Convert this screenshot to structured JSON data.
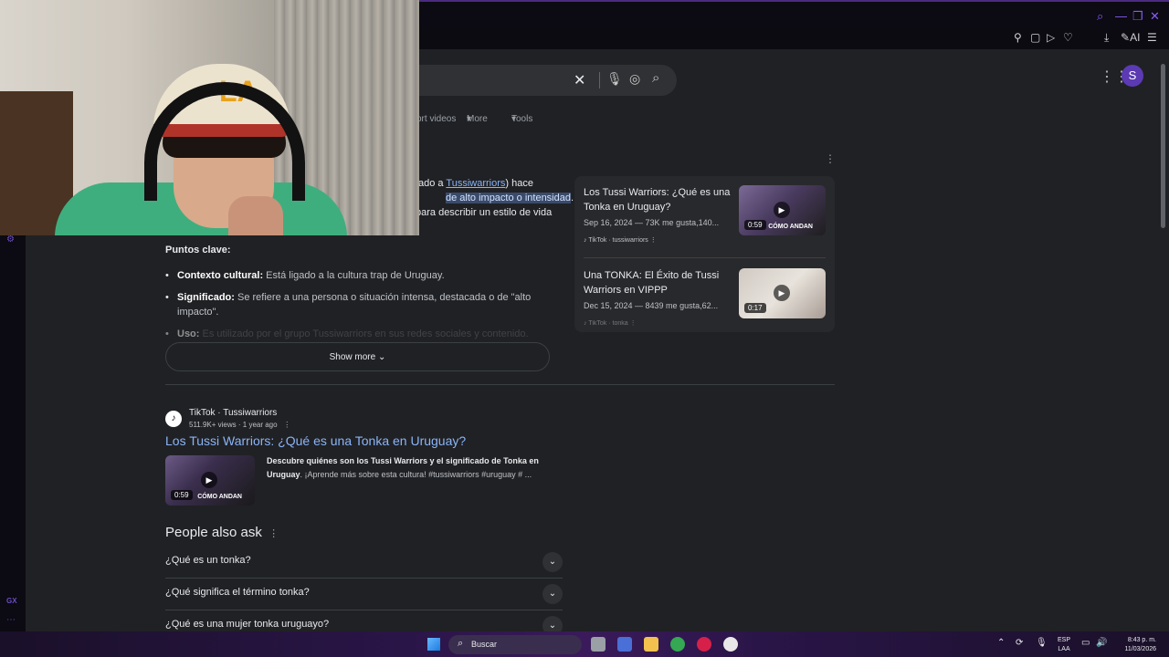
{
  "browser": {
    "toolbar_ai_label": "AI",
    "profile_letter": "S"
  },
  "search": {
    "filters": {
      "short_videos": "ort videos",
      "more": "More",
      "tools": "Tools"
    },
    "avatar_letter": "S"
  },
  "overview": {
    "line1_pre": "ado a ",
    "line1_link": "Tussiwarriors",
    "line1_post": ") hace",
    "line2_hl": "de alto impacto o intensidad",
    "line2_post": ".",
    "line3": "para describir un estilo de vida",
    "keypoints_heading": "Puntos clave:",
    "points": [
      {
        "label": "Contexto cultural:",
        "text": " Está ligado a la cultura trap de Uruguay."
      },
      {
        "label": "Significado:",
        "text": " Se refiere a una persona o situación intensa, destacada o de \"alto impacto\"."
      },
      {
        "label": "Uso:",
        "text": " Es utilizado por el grupo Tussiwarriors en sus redes sociales y contenido."
      }
    ],
    "show_more": "Show more"
  },
  "result": {
    "source_name": "TikTok · Tussiwarriors",
    "source_meta": "511.9K+ views · 1 year ago",
    "title": "Los Tussi Warriors: ¿Qué es una Tonka en Uruguay?",
    "desc_bold": "Descubre quiénes son los Tussi Warriors y el significado de Tonka en Uruguay",
    "desc_rest": ". ¡Aprende más sobre esta cultura! #tussiwarriors #uruguay # ...",
    "duration": "0:59",
    "thumb_caption": "CÓMO ANDAN"
  },
  "videos": [
    {
      "title": "Los Tussi Warriors: ¿Qué es una Tonka en Uruguay?",
      "meta": "Sep 16, 2024 — 73K me gusta,140...",
      "source": "TikTok · tussiwarriors",
      "duration": "0:59",
      "caption": "CÓMO ANDAN"
    },
    {
      "title": "Una TONKA: El Éxito de Tussi Warriors en VIPPP",
      "meta": "Dec 15, 2024 — 8439 me gusta,62...",
      "source": "TikTok · tonka",
      "duration": "0:17",
      "caption": ""
    }
  ],
  "paa": {
    "title": "People also ask",
    "questions": [
      "¿Qué es un tonka?",
      "¿Qué significa el término tonka?",
      "¿Qué es una mujer tonka uruguayo?"
    ]
  },
  "taskbar": {
    "search_placeholder": "Buscar",
    "lang_line1": "ESP",
    "lang_line2": "LAA",
    "time": "8:43 p. m.",
    "date": "11/03/2026"
  },
  "colors": {
    "accent": "#8a5cf6",
    "link": "#8ab4f8",
    "page_bg": "#202124"
  }
}
